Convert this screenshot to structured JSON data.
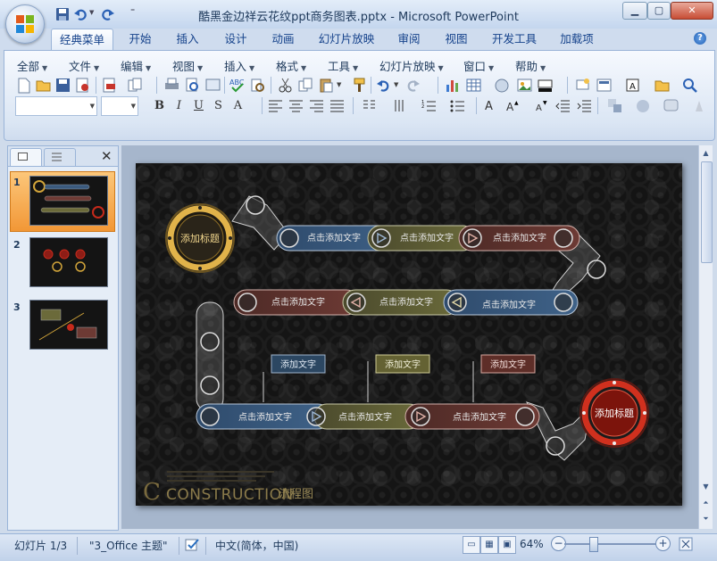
{
  "window": {
    "title": "酷黑金边祥云花纹ppt商务图表.pptx - Microsoft PowerPoint",
    "buttons": [
      "▁",
      "▢",
      "✕"
    ]
  },
  "ribbon": {
    "tabs": [
      "经典菜单",
      "开始",
      "插入",
      "设计",
      "动画",
      "幻灯片放映",
      "审阅",
      "视图",
      "开发工具",
      "加载项"
    ],
    "active_tab": "经典菜单",
    "menus": [
      "全部",
      "文件",
      "编辑",
      "视图",
      "插入",
      "格式",
      "工具",
      "幻灯片放映",
      "窗口",
      "帮助"
    ],
    "format_buttons": [
      "B",
      "I",
      "U",
      "S",
      "A"
    ],
    "help": "?"
  },
  "slides_pane": {
    "close": "✕",
    "thumbnails": [
      {
        "number": "1",
        "selected": true
      },
      {
        "number": "2",
        "selected": false
      },
      {
        "number": "3",
        "selected": false
      }
    ]
  },
  "slide": {
    "start_badge": "添加标题",
    "end_badge": "添加标题",
    "row1_labels": [
      "点击添加文字",
      "点击添加文字",
      "点击添加文字"
    ],
    "row2_labels": [
      "点击添加文字",
      "点击添加文字",
      "点击添加文字"
    ],
    "row3_labels": [
      "点击添加文字",
      "点击添加文字",
      "点击添加文字"
    ],
    "callouts": [
      "添加文字",
      "添加文字",
      "添加文字"
    ],
    "footer_title": "CONSTRUCTION",
    "footer_subtitle": "流程图",
    "colors": {
      "blue": "#3b5a7d",
      "olive": "#6b6a3a",
      "red": "#6d3a34",
      "gold": "#d1a43a",
      "ring_red": "#c62a1b"
    }
  },
  "status": {
    "slide_indicator": "幻灯片 1/3",
    "theme": "\"3_Office 主题\"",
    "language": "中文(简体，中国)",
    "zoom": "64%",
    "zoom_fraction": 0.33
  }
}
